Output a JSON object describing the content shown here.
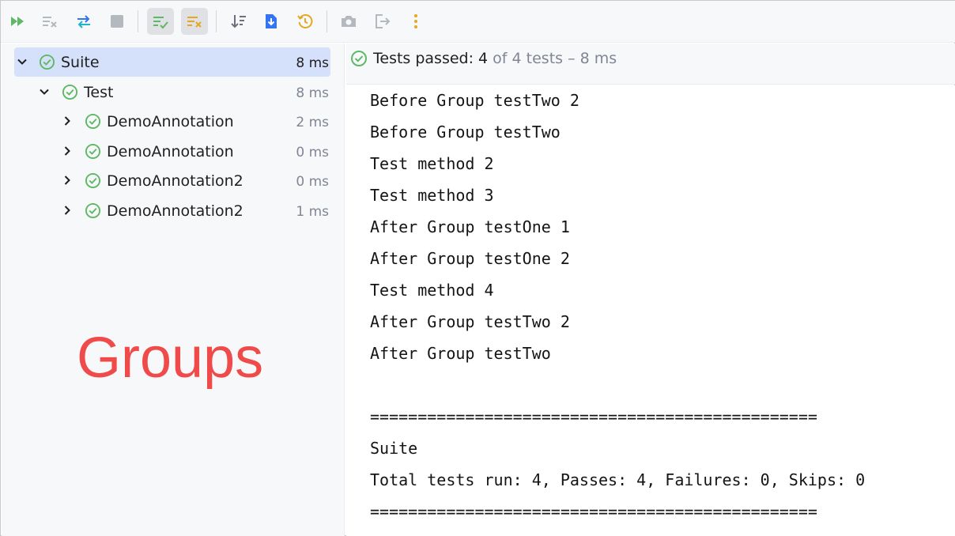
{
  "toolbar": {
    "buttons": [
      {
        "icon": "rerun-tests-icon",
        "color": "#5fb865"
      },
      {
        "icon": "rerun-failed-tests-icon",
        "color": "#b4b8bf"
      },
      {
        "icon": "toggle-auto-test-icon",
        "color": "#3574f0"
      },
      {
        "icon": "stop-icon",
        "color": "#b4b8bf"
      },
      {
        "icon": "show-passed-icon",
        "color": "#5fb865",
        "active": true
      },
      {
        "icon": "show-ignored-icon",
        "color": "#e5a823",
        "active": true
      },
      {
        "icon": "sort-icon",
        "color": "#6c707e"
      },
      {
        "icon": "import-tests-icon",
        "color": "#3574f0"
      },
      {
        "icon": "test-history-icon",
        "color": "#e5a823"
      },
      {
        "icon": "screenshot-icon",
        "color": "#b4b8bf"
      },
      {
        "icon": "export-icon",
        "color": "#b4b8bf"
      },
      {
        "icon": "more-options-icon",
        "color": "#e5a823"
      }
    ]
  },
  "tree": {
    "rows": [
      {
        "label": "Suite",
        "duration": "8 ms",
        "status": "passed",
        "expanded": true,
        "selected": true
      },
      {
        "label": "Test",
        "duration": "8 ms",
        "status": "passed",
        "expanded": true,
        "selected": false
      },
      {
        "label": "DemoAnnotation",
        "duration": "2 ms",
        "status": "passed",
        "expanded": false,
        "selected": false
      },
      {
        "label": "DemoAnnotation",
        "duration": "0 ms",
        "status": "passed",
        "expanded": false,
        "selected": false
      },
      {
        "label": "DemoAnnotation2",
        "duration": "0 ms",
        "status": "passed",
        "expanded": false,
        "selected": false
      },
      {
        "label": "DemoAnnotation2",
        "duration": "1 ms",
        "status": "passed",
        "expanded": false,
        "selected": false
      }
    ]
  },
  "overlay_label": "Groups",
  "status": {
    "prefix": "Tests passed: ",
    "passed": "4",
    "suffix": " of 4 tests – 8 ms"
  },
  "console": {
    "lines": [
      "Before Group testTwo 2",
      "Before Group testTwo",
      "Test method 2",
      "Test method 3",
      "After Group testOne 1",
      "After Group testOne 2",
      "Test method 4",
      "After Group testTwo 2",
      "After Group testTwo",
      "",
      "===============================================",
      "Suite",
      "Total tests run: 4, Passes: 4, Failures: 0, Skips: 0",
      "==============================================="
    ]
  },
  "colors": {
    "success": "#5fb865",
    "overlay": "#f04b4b",
    "selection": "#d5e1fb",
    "muted_text": "#818594"
  }
}
